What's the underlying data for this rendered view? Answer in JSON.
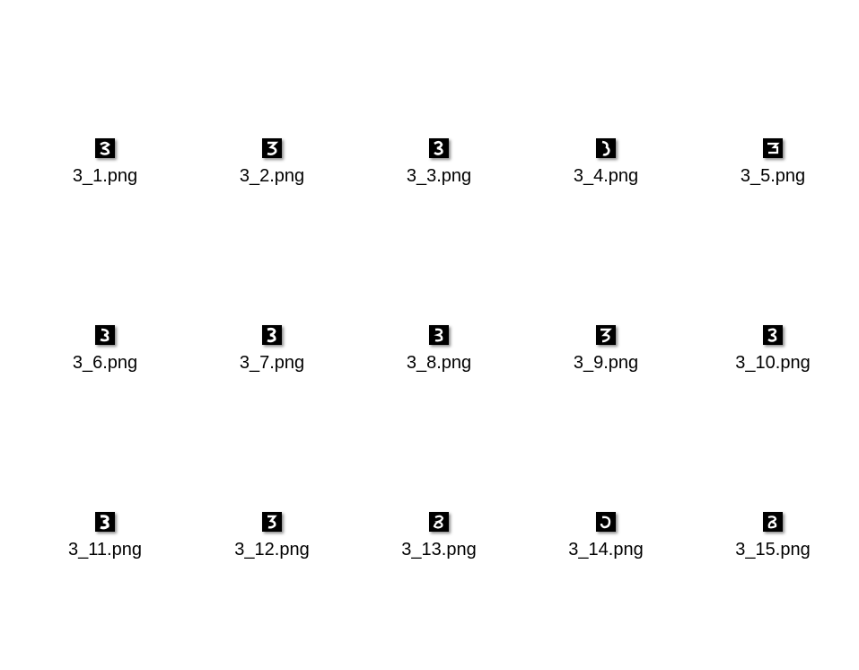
{
  "files": [
    {
      "name": "3_1.png",
      "glyph": "3a"
    },
    {
      "name": "3_2.png",
      "glyph": "3b"
    },
    {
      "name": "3_3.png",
      "glyph": "3b"
    },
    {
      "name": "3_4.png",
      "glyph": "3c"
    },
    {
      "name": "3_5.png",
      "glyph": "3d"
    },
    {
      "name": "3_6.png",
      "glyph": "3c"
    },
    {
      "name": "3_7.png",
      "glyph": "3b"
    },
    {
      "name": "3_8.png",
      "glyph": "3b"
    },
    {
      "name": "3_9.png",
      "glyph": "3e"
    },
    {
      "name": "3_10.png",
      "glyph": "3b"
    },
    {
      "name": "3_11.png",
      "glyph": "3b"
    },
    {
      "name": "3_12.png",
      "glyph": "3b"
    },
    {
      "name": "3_13.png",
      "glyph": "3d"
    },
    {
      "name": "3_14.png",
      "glyph": "3f"
    },
    {
      "name": "3_15.png",
      "glyph": "3d"
    }
  ]
}
